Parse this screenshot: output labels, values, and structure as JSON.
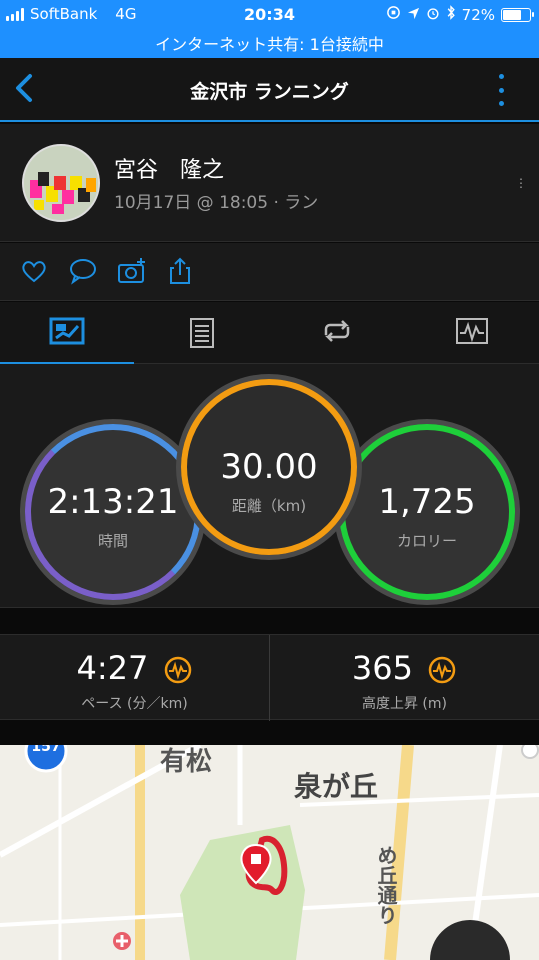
{
  "status_bar": {
    "carrier": "SoftBank",
    "network": "4G",
    "time": "20:34",
    "battery": "72%",
    "battery_level": 0.72,
    "hotspot": "インターネット共有: 1台接続中"
  },
  "header": {
    "title": "金沢市 ランニング"
  },
  "profile": {
    "name": "宮谷　隆之",
    "meta": "10月17日 @ 18:05 · ラン",
    "extra": "⋮"
  },
  "actions": [
    "heart-icon",
    "comment-icon",
    "add-photo-icon",
    "share-icon"
  ],
  "tabs": [
    "summary",
    "details",
    "laps",
    "charts"
  ],
  "stats": {
    "time": {
      "value": "2:13:21",
      "label": "時間"
    },
    "distance": {
      "value": "30.00",
      "label": "距離（km)"
    },
    "calories": {
      "value": "1,725",
      "label": "カロリー"
    }
  },
  "metrics": {
    "pace": {
      "value": "4:27",
      "label": "ペース (分／km)"
    },
    "elevation": {
      "value": "365",
      "label": "高度上昇 (m)"
    }
  },
  "map": {
    "route_badge": "157",
    "labels": [
      "有松",
      "泉が丘",
      "め丘通り"
    ],
    "colors": {
      "route": "#d8212f",
      "park": "#cfe6b8",
      "road": "#f6d98a"
    }
  },
  "colors": {
    "accent": "#1d8fe0",
    "time_ring": "#4a90e2",
    "distance_ring": "#f39c12",
    "calories_ring": "#1ecf3a"
  }
}
